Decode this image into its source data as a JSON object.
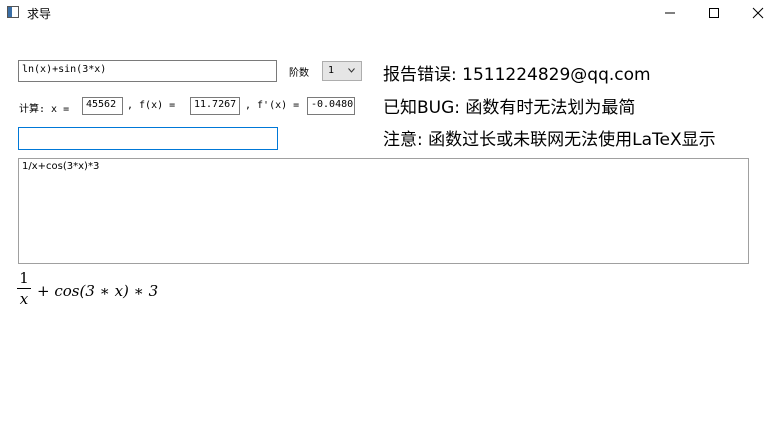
{
  "window": {
    "title": "求导",
    "minimize_icon": "minimize-icon",
    "maximize_icon": "maximize-icon",
    "close_icon": "close-icon"
  },
  "function_input": {
    "value": "ln(x)+sin(3*x)"
  },
  "order": {
    "label": "阶数",
    "selected": "1"
  },
  "eval": {
    "calc_label": "计算: x =",
    "x_value": "45562",
    "fx_label": ", f(x) =",
    "fx_value": "11.7267",
    "dfx_label": ", f'(x) =",
    "dfx_value": "-0.0480"
  },
  "empty_input": {
    "value": ""
  },
  "output": {
    "text": "1/x+cos(3*x)*3"
  },
  "notes": [
    "报告错误: 1511224829@qq.com",
    "已知BUG: 函数有时无法划为最简",
    "注意: 函数过长或未联网无法使用LaTeX显示"
  ],
  "latex": {
    "numerator": "1",
    "denominator": "x",
    "rest": "+ cos(3 ∗ x) ∗ 3"
  }
}
